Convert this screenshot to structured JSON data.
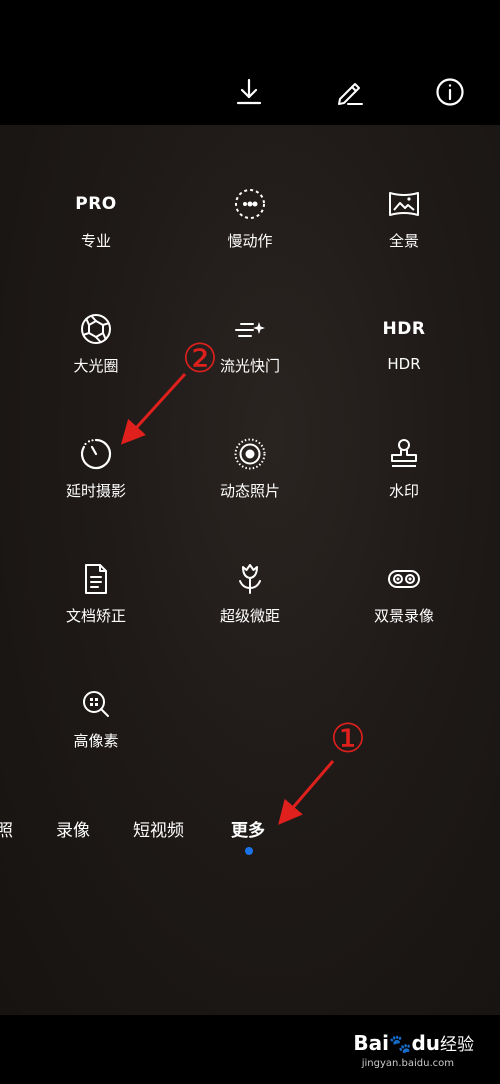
{
  "toolbar": {
    "icons": [
      "download-icon",
      "edit-icon",
      "info-icon"
    ]
  },
  "modes": [
    {
      "label": "专业",
      "icon_text": "PRO"
    },
    {
      "label": "慢动作",
      "icon": "slow-motion-icon"
    },
    {
      "label": "全景",
      "icon": "panorama-icon"
    },
    {
      "label": "大光圈",
      "icon": "aperture-icon"
    },
    {
      "label": "流光快门",
      "icon": "light-painting-icon"
    },
    {
      "label": "HDR",
      "icon_text": "HDR"
    },
    {
      "label": "延时摄影",
      "icon": "timelapse-icon"
    },
    {
      "label": "动态照片",
      "icon": "moving-picture-icon"
    },
    {
      "label": "水印",
      "icon": "watermark-stamp-icon"
    },
    {
      "label": "文档矫正",
      "icon": "document-icon"
    },
    {
      "label": "超级微距",
      "icon": "super-macro-icon"
    },
    {
      "label": "双景录像",
      "icon": "dual-view-icon"
    },
    {
      "label": "高像素",
      "icon": "high-res-icon"
    }
  ],
  "tabs": [
    {
      "label": "照"
    },
    {
      "label": "录像"
    },
    {
      "label": "短视频"
    },
    {
      "label": "更多",
      "active": true
    }
  ],
  "annotations": {
    "badge1": "①",
    "badge2": "②",
    "arrow_color": "#e0201c"
  },
  "watermark": {
    "brand": "Bai",
    "brand2": "du",
    "cn": "经验",
    "url": "jingyan.baidu.com"
  },
  "colors": {
    "active_dot": "#1a73e8"
  }
}
